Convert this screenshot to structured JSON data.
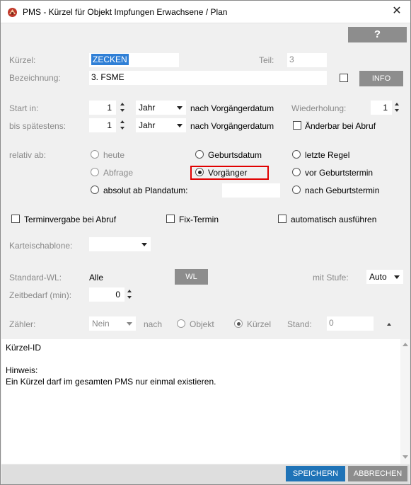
{
  "window": {
    "title": "PMS - Kürzel für Objekt Impfungen Erwachsene / Plan"
  },
  "toolbar": {
    "help_label": "?"
  },
  "kuerzel": {
    "label": "Kürzel:",
    "value": "ZECKEN",
    "teil_label": "Teil:",
    "teil_value": "3"
  },
  "bezeichnung": {
    "label": "Bezeichnung:",
    "value": "3. FSME",
    "info_label": "INFO"
  },
  "start_in": {
    "label": "Start in:",
    "value": "1",
    "unit": "Jahr",
    "suffix": "nach Vorgängerdatum"
  },
  "bis_spaetestens": {
    "label": "bis spätestens:",
    "value": "1",
    "unit": "Jahr",
    "suffix": "nach Vorgängerdatum"
  },
  "wiederholung": {
    "label": "Wiederholung:",
    "value": "1"
  },
  "aenderbar": {
    "label": "Änderbar bei Abruf",
    "checked": false
  },
  "relativ_ab": {
    "label": "relativ ab:",
    "options": {
      "heute": "heute",
      "abfrage": "Abfrage",
      "absolut": "absolut ab Plandatum:",
      "geburtsdatum": "Geburtsdatum",
      "vorgaenger": "Vorgänger",
      "letzte_regel": "letzte Regel",
      "vor_geburtstermin": "vor Geburtstermin",
      "nach_geburtstermin": "nach Geburtstermin"
    },
    "selected": "Vorgänger"
  },
  "optionen": {
    "terminvergabe": "Terminvergabe bei Abruf",
    "fix_termin": "Fix-Termin",
    "automatisch": "automatisch ausführen"
  },
  "karteischablone": {
    "label": "Karteischablone:",
    "value": ""
  },
  "standard_wl": {
    "label": "Standard-WL:",
    "value": "Alle",
    "button_label": "WL",
    "stufe_label": "mit Stufe:",
    "stufe_value": "Auto"
  },
  "zeitbedarf": {
    "label": "Zeitbedarf (min):",
    "value": "0"
  },
  "zaehler": {
    "label": "Zähler:",
    "value": "Nein",
    "nach_label": "nach",
    "objekt_label": "Objekt",
    "kuerzel_label": "Kürzel",
    "selected": "Kürzel",
    "stand_label": "Stand:",
    "stand_value": "0"
  },
  "hint": {
    "line1": "Kürzel-ID",
    "line2": "Hinweis:",
    "line3": "Ein Kürzel darf im gesamten PMS nur einmal existieren."
  },
  "footer": {
    "save_label": "SPEICHERN",
    "cancel_label": "ABBRECHEN"
  },
  "colors": {
    "accent": "#1f73b7",
    "highlight": "#e00000",
    "selection": "#2f7fd6",
    "button_gray": "#8d8d8d"
  },
  "icons": {
    "app": "app-logo-icon",
    "close": "close-icon"
  }
}
